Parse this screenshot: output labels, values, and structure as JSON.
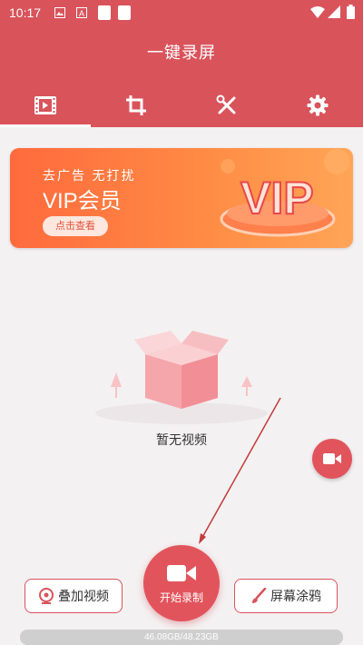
{
  "status_bar": {
    "time": "10:17",
    "icons": [
      "image-icon",
      "a-icon",
      "square-icon",
      "square-icon",
      "wifi-icon",
      "signal-icon",
      "battery-icon"
    ]
  },
  "header": {
    "title": "一键录屏",
    "tabs": [
      {
        "name": "videos",
        "icon": "film-icon",
        "selected": true
      },
      {
        "name": "crop",
        "icon": "crop-icon",
        "selected": false
      },
      {
        "name": "tools",
        "icon": "tools-icon",
        "selected": false
      },
      {
        "name": "settings",
        "icon": "gear-icon",
        "selected": false
      }
    ]
  },
  "banner": {
    "line1": "去广告  无打扰",
    "line2": "VIP会员",
    "button": "点击查看",
    "art_text": "VIP"
  },
  "empty_state": {
    "text": "暂无视频"
  },
  "actions": {
    "overlay_video": "叠加视频",
    "start_record": "开始录制",
    "screen_doodle": "屏幕涂鸦"
  },
  "storage": {
    "text": "46.08GB/48.23GB",
    "used_fraction": 0.955
  },
  "colors": {
    "primary": "#d9535b",
    "record": "#e2545c",
    "banner_start": "#ff6a3d",
    "banner_end": "#ffa557"
  }
}
